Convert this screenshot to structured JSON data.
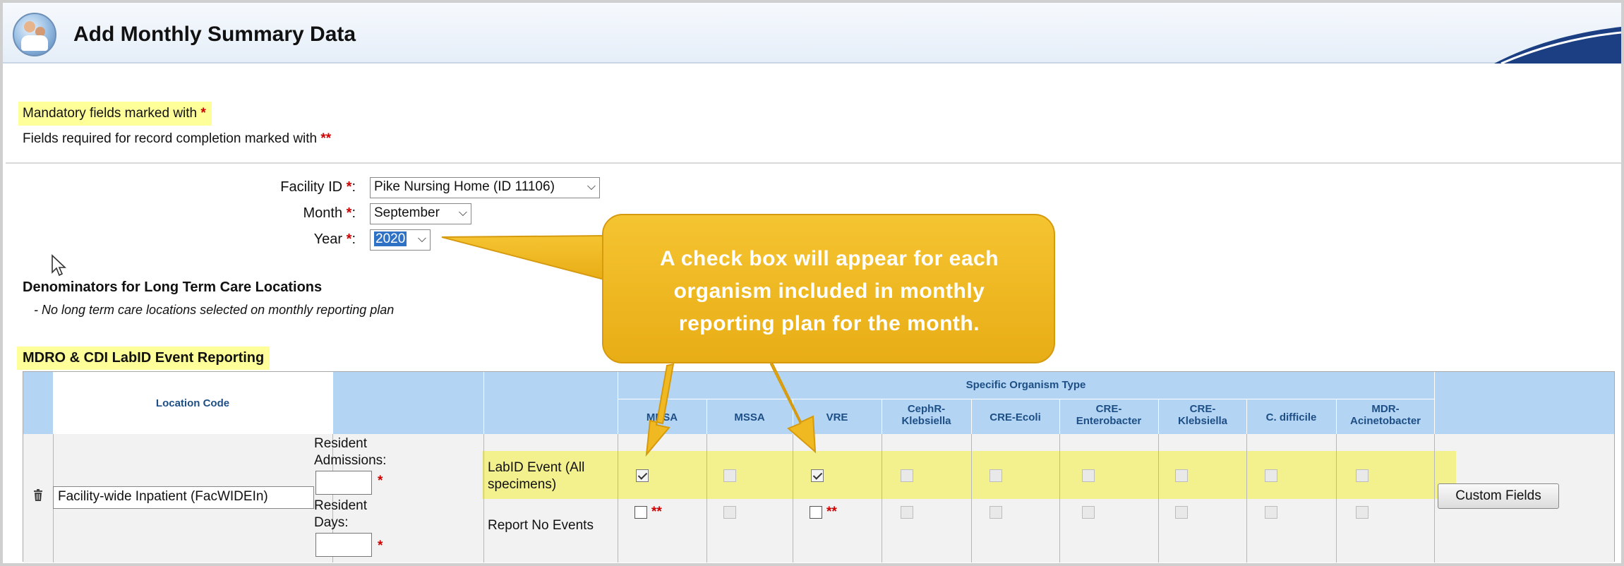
{
  "header": {
    "title": "Add Monthly Summary Data"
  },
  "legend": {
    "mandatory_label": "Mandatory fields marked with",
    "mandatory_mark": "*",
    "completion_label": "Fields required for record completion marked with",
    "completion_mark": "**"
  },
  "form": {
    "facility_label": "Facility ID",
    "facility_value": "Pike Nursing Home (ID 11106)",
    "month_label": "Month",
    "month_value": "September",
    "year_label": "Year",
    "year_value": "2020",
    "req_mark": "*",
    "colon": ":"
  },
  "denominators": {
    "title": "Denominators for Long Term Care Locations",
    "note": "- No long term care locations selected on monthly reporting plan"
  },
  "mdro": {
    "title": "MDRO & CDI LabID Event Reporting",
    "location_code_header": "Location Code",
    "organism_group_header": "Specific Organism Type",
    "organisms": [
      "MRSA",
      "MSSA",
      "VRE",
      "CephR-Klebsiella",
      "CRE-Ecoli",
      "CRE-Enterobacter",
      "CRE-Klebsiella",
      "C. difficile",
      "MDR-Acinetobacter"
    ],
    "location_value": "Facility-wide Inpatient (FacWIDEIn)",
    "resident_admissions_label": "Resident Admissions:",
    "resident_days_label": "Resident Days:",
    "req_mark": "*",
    "row1_label": "LabID Event (All specimens)",
    "row2_label": "Report No Events",
    "double_mark": "**",
    "custom_fields_button": "Custom Fields"
  },
  "callout": {
    "line1": "A check box will appear for each",
    "line2": "organism included in monthly",
    "line3": "reporting plan for the month."
  },
  "colors": {
    "header_blue": "#b3d4f2",
    "highlight_yellow": "#ffff99",
    "callout_gold": "#f0b921",
    "required_red": "#d00000"
  }
}
